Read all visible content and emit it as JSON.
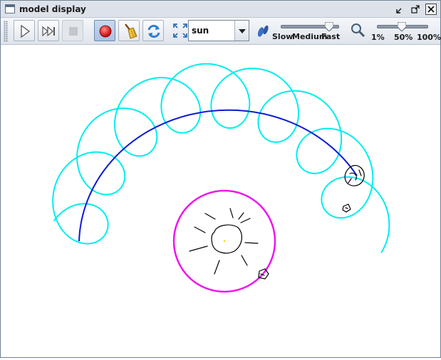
{
  "window": {
    "title": "model display"
  },
  "toolbar": {
    "selected_body": "sun",
    "speed_labels": [
      "Slow",
      "Medium",
      "Fast"
    ],
    "speed_level": 0.85,
    "zoom_labels": [
      "1%",
      "50%",
      "100%"
    ],
    "zoom_level": 0.5
  },
  "colors": {
    "epicycle": "#00eeee",
    "deferent": "#0b1bd6",
    "sun_ring": "#ee14ee",
    "sketch": "#000000",
    "record": "#e01010"
  },
  "icons": [
    "play-icon",
    "step-forward-icon",
    "stop-icon",
    "record-icon",
    "broom-icon",
    "refresh-icon",
    "fit-view-icon",
    "feet-icon",
    "magnifier-icon"
  ]
}
